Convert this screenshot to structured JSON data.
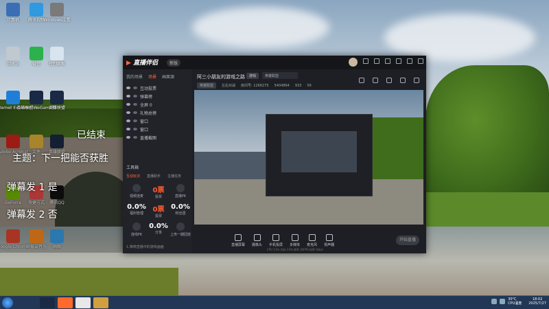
{
  "desktop": {
    "icons": [
      {
        "label": "计算机",
        "color": "#3a6fb5"
      },
      {
        "label": "腾讯视频",
        "color": "#2f9ae0"
      },
      {
        "label": "Windows设置",
        "color": "#7a7a7a"
      },
      {
        "label": "回收站",
        "color": "#c0c8d0"
      },
      {
        "label": "微信",
        "color": "#2bb24c"
      },
      {
        "label": "控制面板",
        "color": "#d8e4ee"
      },
      {
        "label": "Internet Explorer",
        "color": "#1f7fd8"
      },
      {
        "label": "英雄联盟WeGame版",
        "color": "#1a2a44"
      },
      {
        "label": "英雄联盟",
        "color": "#1a2a44"
      },
      {
        "label": "Adobe Acrobat",
        "color": "#d0241c"
      },
      {
        "label": "文件",
        "color": "#e0b03a"
      },
      {
        "label": "英雄联盟",
        "color": "#1a2a44"
      },
      {
        "label": "GeForce",
        "color": "#76b900"
      },
      {
        "label": "快捷方式",
        "color": "#e54a4a"
      },
      {
        "label": "腾讯QQ",
        "color": "#111111"
      },
      {
        "label": "Google Chrome",
        "color": "#e0462f"
      },
      {
        "label": "网易云音乐",
        "color": "#ff8a1c"
      },
      {
        "label": "画图",
        "color": "#3aa0e8"
      }
    ],
    "overlay": {
      "ended": "已结束",
      "topic": "主题：下一把能否获胜",
      "option1": "弹幕发 1 是",
      "option2": "弹幕发 2 否"
    }
  },
  "app": {
    "name": "直播伴侣",
    "version": "新版",
    "side_tabs": [
      "我的场景",
      "场景",
      "画面源"
    ],
    "active_side_tab": 1,
    "sources": [
      "互动投票",
      "弹幕榜",
      "全屏 0",
      "礼物总榜",
      "窗口",
      "窗口",
      "直播截图"
    ],
    "tools_title": "工具箱",
    "tools_tabs": [
      "互动玩法",
      "直播助手",
      "主播任务"
    ],
    "tools": [
      {
        "label": "视频连麦",
        "value": ""
      },
      {
        "label": "投票",
        "value": "0票",
        "orange": true
      },
      {
        "label": "直播PK",
        "value": ""
      },
      {
        "label": "福利管理",
        "value": "0.0%"
      },
      {
        "label": "投票",
        "value": "0票",
        "orange": true
      },
      {
        "label": "粉丝团",
        "value": "0.0%"
      },
      {
        "label": "连线PK",
        "value": ""
      },
      {
        "label": "分享",
        "value": "0.0%"
      },
      {
        "label": "上传一期回放",
        "value": ""
      }
    ],
    "tip": "1.推荐直播中的游戏画面",
    "room": {
      "title": "阿三小朋友的游戏之路",
      "badge": "游戏",
      "select": "英雄联盟",
      "meta_tag": "英雄联盟",
      "meta_label": "左右对战",
      "viewer_id": "房间号: 1266275",
      "fans": "5404864",
      "likes": "933",
      "online": "56"
    },
    "bottom_actions": [
      "直播屏幕",
      "摄像头",
      "手机投屏",
      "多媒体",
      "麦克风",
      "扬声器"
    ],
    "live_button": "开始直播",
    "status": "CPU 11%  内存 23%  帧率 30FPS  码率 0kb/s"
  },
  "taskbar": {
    "apps": [
      {
        "color": "#1a2a44"
      },
      {
        "color": "#ff6a2c"
      },
      {
        "color": "#e8e8e8"
      },
      {
        "color": "#d0a040"
      }
    ],
    "weather": "30°C",
    "weather_desc": "CPU温度",
    "time": "18:02",
    "date": "2025/7/27"
  }
}
